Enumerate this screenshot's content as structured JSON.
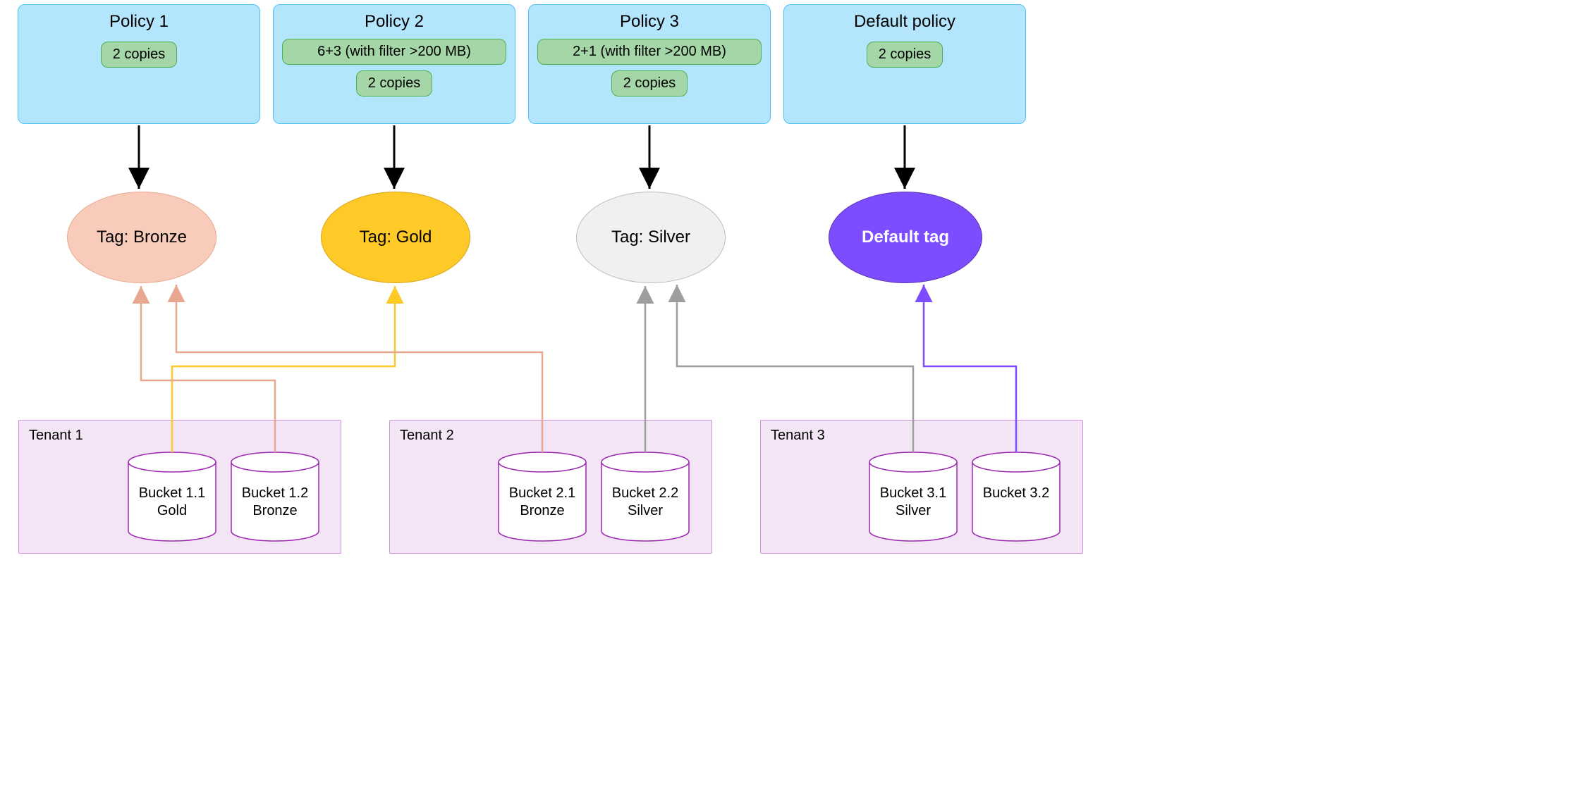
{
  "policies": [
    {
      "title": "Policy 1",
      "pills": [
        "2 copies"
      ]
    },
    {
      "title": "Policy 2",
      "pills": [
        "6+3 (with filter >200 MB)",
        "2 copies"
      ]
    },
    {
      "title": "Policy 3",
      "pills": [
        "2+1 (with filter >200 MB)",
        "2 copies"
      ]
    },
    {
      "title": "Default policy",
      "pills": [
        "2 copies"
      ]
    }
  ],
  "tags": [
    {
      "label": "Tag: Bronze",
      "kind": "bronze"
    },
    {
      "label": "Tag: Gold",
      "kind": "gold"
    },
    {
      "label": "Tag: Silver",
      "kind": "silver"
    },
    {
      "label": "Default tag",
      "kind": "default"
    }
  ],
  "tenants": [
    {
      "label": "Tenant 1",
      "buckets": [
        {
          "line1": "Bucket 1.1",
          "line2": "Gold",
          "link": "gold"
        },
        {
          "line1": "Bucket 1.2",
          "line2": "Bronze",
          "link": "bronze"
        }
      ]
    },
    {
      "label": "Tenant 2",
      "buckets": [
        {
          "line1": "Bucket 2.1",
          "line2": "Bronze",
          "link": "bronze"
        },
        {
          "line1": "Bucket 2.2",
          "line2": "Silver",
          "link": "silver"
        }
      ]
    },
    {
      "label": "Tenant 3",
      "buckets": [
        {
          "line1": "Bucket 3.1",
          "line2": "Silver",
          "link": "silver"
        },
        {
          "line1": "Bucket 3.2",
          "line2": "",
          "link": "default"
        }
      ]
    }
  ],
  "colors": {
    "bronze": "#E8A88F",
    "gold": "#FFCA28",
    "silver": "#9E9E9E",
    "default": "#7C4DFF",
    "black": "#000000"
  }
}
